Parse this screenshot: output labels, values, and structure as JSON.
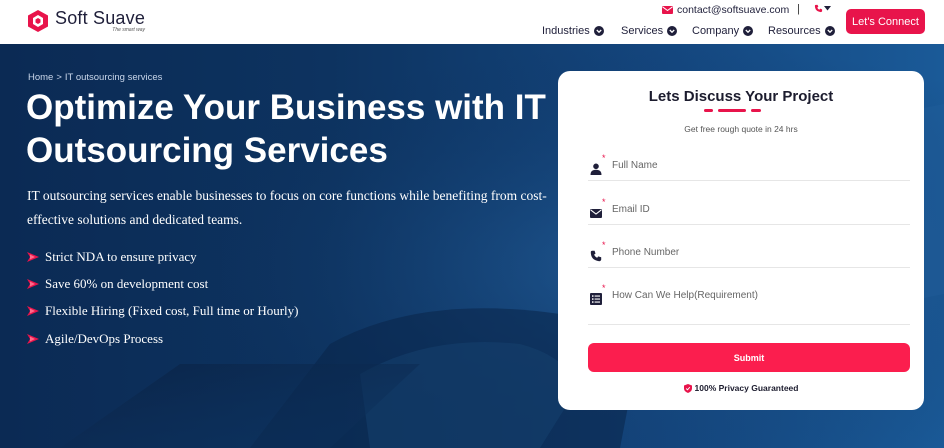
{
  "brand": {
    "name": "Soft Suave",
    "tagline": "The smart way",
    "accent": "#e8144b",
    "logo_icon": "hexagon-logo-icon"
  },
  "header": {
    "email": "contact@softsuave.com",
    "email_icon": "mail-icon",
    "phone_icon": "phone-icon",
    "separator": "|",
    "nav": [
      "Industries",
      "Services",
      "Company",
      "Resources"
    ],
    "cta_label": "Let's Connect"
  },
  "hero": {
    "breadcrumb": {
      "home": "Home",
      "sep": ">",
      "current": "IT outsourcing services"
    },
    "title": "Optimize Your Business with IT Outsourcing Services",
    "description": "IT outsourcing services enable businesses to focus on core functions while benefiting from cost-effective solutions and dedicated teams.",
    "features": [
      "Strict NDA to ensure privacy",
      "Save 60% on development cost",
      "Flexible Hiring (Fixed cost, Full time or Hourly)",
      "Agile/DevOps Process"
    ],
    "background": "#0d3360"
  },
  "form": {
    "title": "Lets Discuss Your Project",
    "subtitle": "Get free rough quote in 24 hrs",
    "required_mark": "*",
    "fields": [
      {
        "icon": "user-icon",
        "placeholder": "Full Name",
        "value": ""
      },
      {
        "icon": "envelope-icon",
        "placeholder": "Email ID",
        "value": ""
      },
      {
        "icon": "phone-icon",
        "placeholder": "Phone Number",
        "value": ""
      },
      {
        "icon": "list-icon",
        "placeholder": "How Can We Help(Requirement)",
        "value": ""
      }
    ],
    "submit_label": "Submit",
    "privacy_text": "100% Privacy Guaranteed",
    "privacy_icon": "shield-icon"
  }
}
